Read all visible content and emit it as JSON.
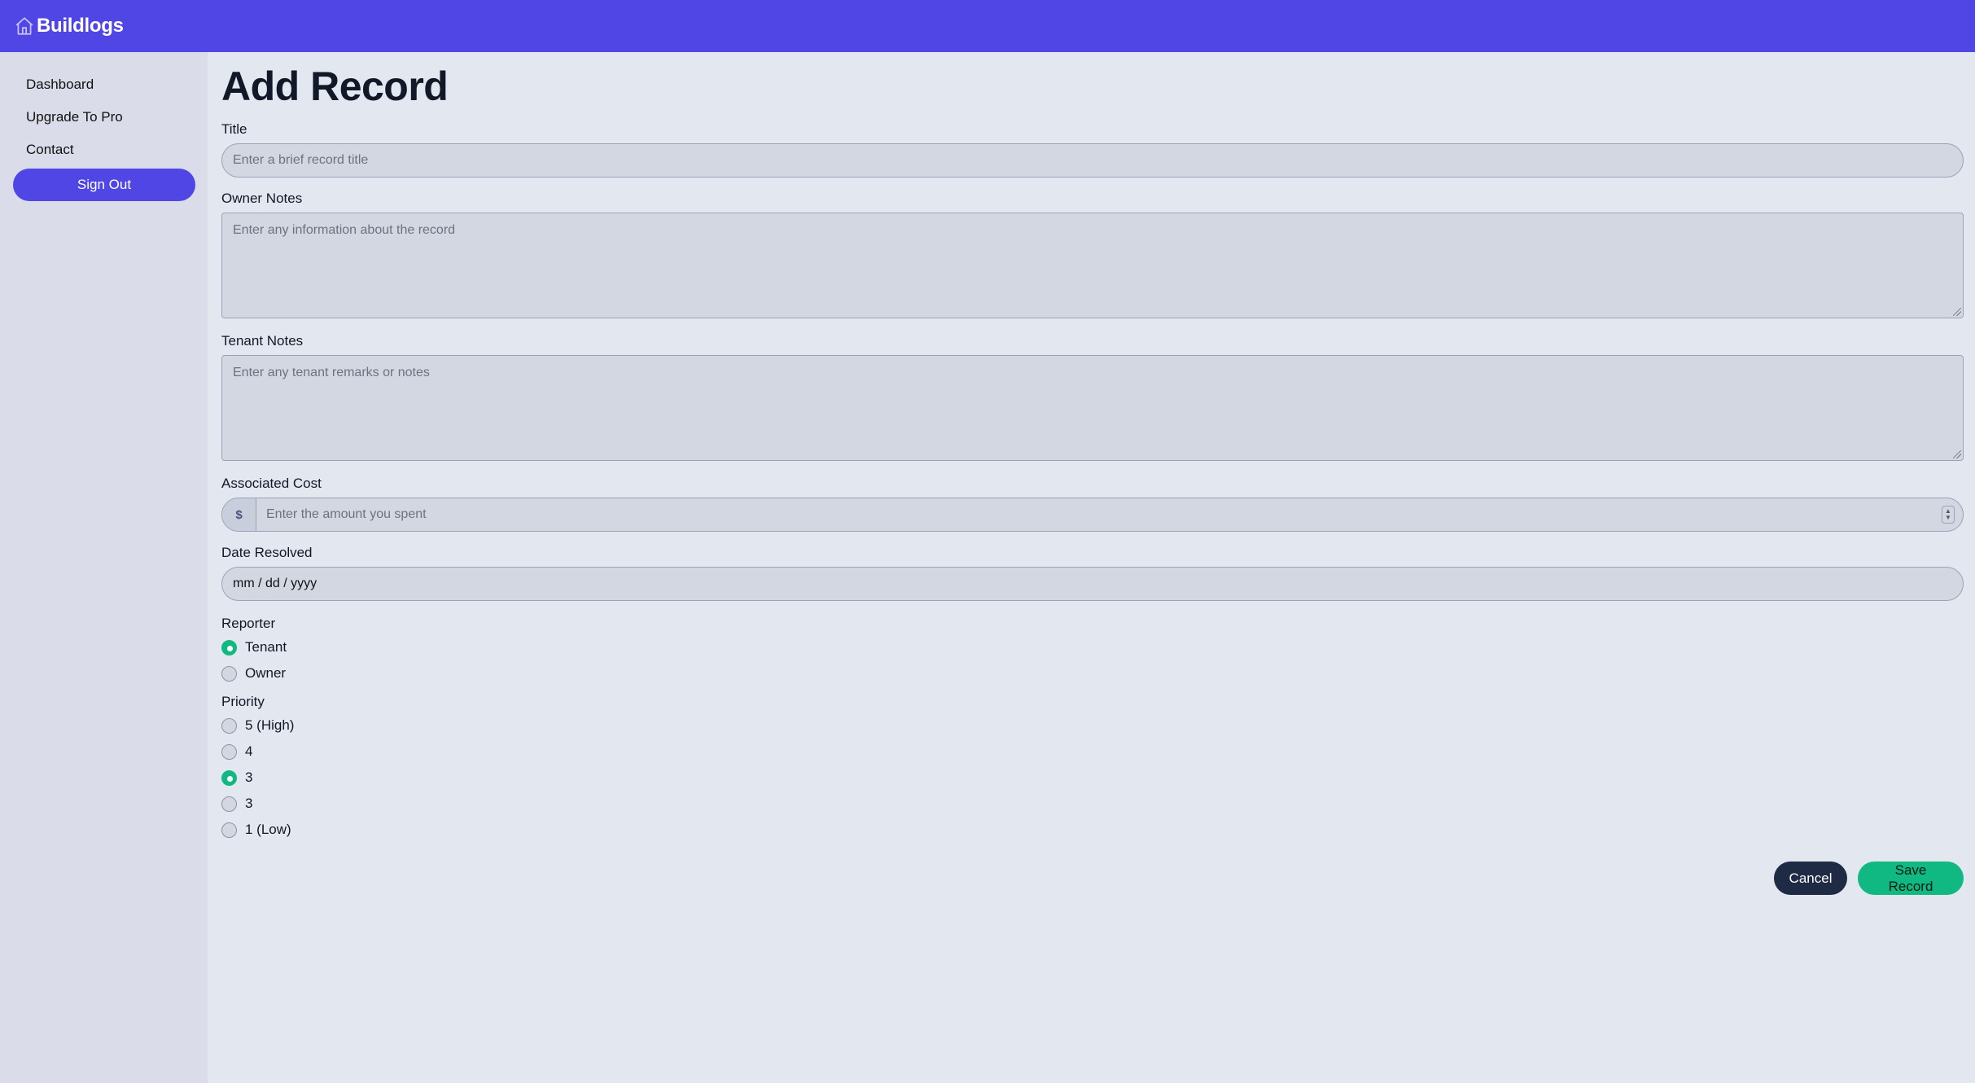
{
  "app": {
    "name": "Buildlogs"
  },
  "sidebar": {
    "items": [
      {
        "label": "Dashboard"
      },
      {
        "label": "Upgrade To Pro"
      },
      {
        "label": "Contact"
      }
    ],
    "sign_out": "Sign Out"
  },
  "page": {
    "title": "Add Record"
  },
  "form": {
    "title": {
      "label": "Title",
      "placeholder": "Enter a brief record title"
    },
    "owner_notes": {
      "label": "Owner Notes",
      "placeholder": "Enter any information about the record"
    },
    "tenant_notes": {
      "label": "Tenant Notes",
      "placeholder": "Enter any tenant remarks or notes"
    },
    "cost": {
      "label": "Associated Cost",
      "prefix": "$",
      "placeholder": "Enter the amount you spent"
    },
    "date": {
      "label": "Date Resolved",
      "value": "mm / dd / yyyy"
    },
    "reporter": {
      "label": "Reporter",
      "options": [
        {
          "label": "Tenant",
          "checked": true
        },
        {
          "label": "Owner",
          "checked": false
        }
      ]
    },
    "priority": {
      "label": "Priority",
      "options": [
        {
          "label": "5 (High)",
          "checked": false
        },
        {
          "label": "4",
          "checked": false
        },
        {
          "label": "3",
          "checked": true
        },
        {
          "label": "3",
          "checked": false
        },
        {
          "label": "1 (Low)",
          "checked": false
        }
      ]
    }
  },
  "actions": {
    "cancel": "Cancel",
    "save": "Save Record"
  },
  "colors": {
    "brand": "#5046e5",
    "accent": "#10b981",
    "dark": "#1f2a44"
  }
}
